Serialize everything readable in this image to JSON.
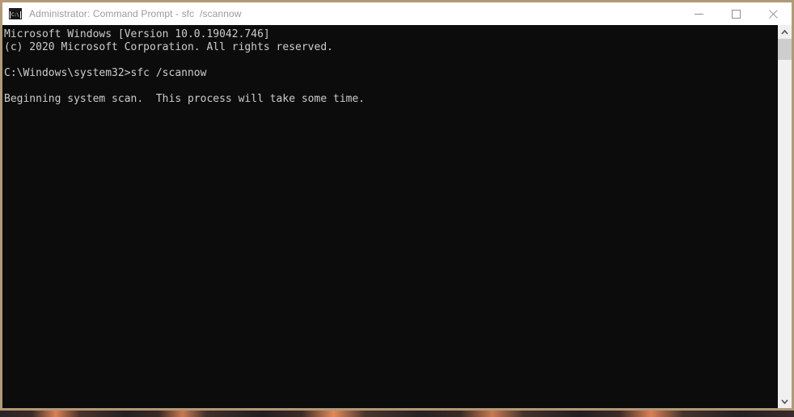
{
  "window": {
    "title": "Administrator: Command Prompt - sfc  /scannow",
    "icon_name": "command-prompt-icon",
    "icon_glyph": "C:\\",
    "border_color": "#b29a77",
    "titlebar_bg": "#ffffff",
    "title_color": "#9b9b9b"
  },
  "controls": {
    "minimize_label": "Minimize",
    "maximize_label": "Maximize",
    "close_label": "Close"
  },
  "console": {
    "background": "#0c0c0c",
    "foreground": "#cccccc",
    "text": "Microsoft Windows [Version 10.0.19042.746]\n(c) 2020 Microsoft Corporation. All rights reserved.\n\nC:\\Windows\\system32>sfc /scannow\n\nBeginning system scan.  This process will take some time.",
    "lines": [
      "Microsoft Windows [Version 10.0.19042.746]",
      "(c) 2020 Microsoft Corporation. All rights reserved.",
      "",
      "C:\\Windows\\system32>sfc /scannow",
      "",
      "Beginning system scan.  This process will take some time."
    ],
    "prompt": "C:\\Windows\\system32>",
    "command": "sfc /scannow",
    "os_version": "10.0.19042.746",
    "copyright_year": "2020"
  },
  "scrollbar": {
    "up_arrow_name": "scroll-up-arrow",
    "down_arrow_name": "scroll-down-arrow",
    "thumb_name": "scrollbar-thumb",
    "track_color": "#f0f0f0",
    "thumb_color": "#cdcdcd"
  },
  "desktop": {
    "wallpaper_description": "dark wallpaper strip"
  }
}
